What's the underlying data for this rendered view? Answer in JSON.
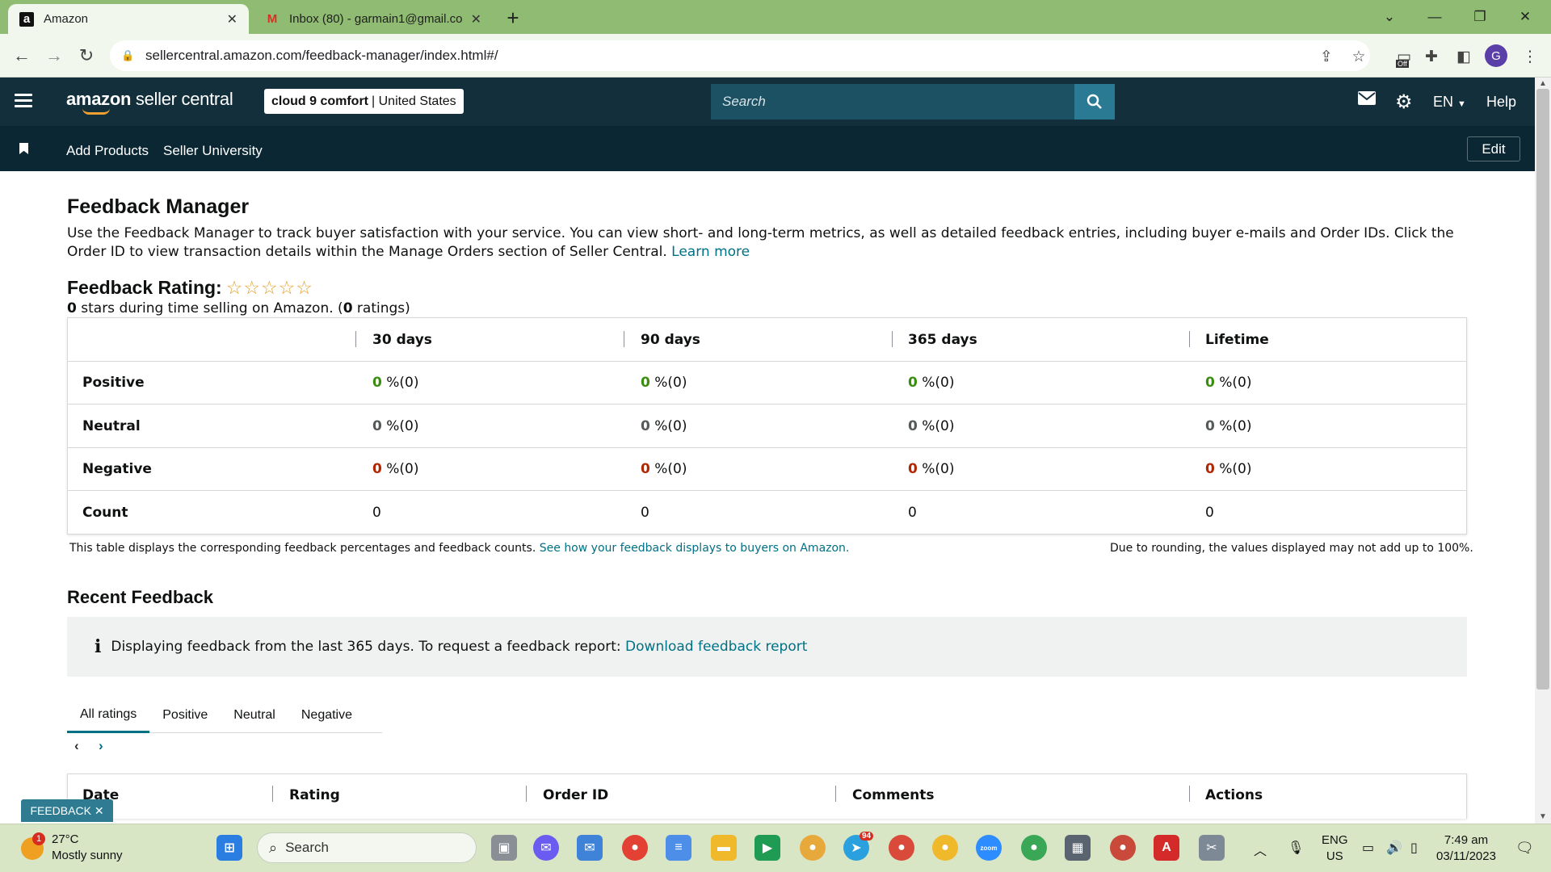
{
  "browser": {
    "tabs": [
      {
        "title": "Amazon",
        "favicon": "a"
      },
      {
        "title": "Inbox (80) - garmain1@gmail.co",
        "favicon": "M"
      }
    ],
    "url": "sellercentral.amazon.com/feedback-manager/index.html#/",
    "profile_initial": "G",
    "ext_badge": "Off"
  },
  "header": {
    "logo_brand": "amazon",
    "logo_rest": " seller central",
    "store_name": "cloud 9 comfort",
    "store_region": "| United States",
    "search_placeholder": "Search",
    "language": "EN",
    "help": "Help"
  },
  "nav": {
    "items": [
      "Add Products",
      "Seller University"
    ],
    "edit": "Edit"
  },
  "page": {
    "title": "Feedback Manager",
    "description": "Use the Feedback Manager to track buyer satisfaction with your service. You can view short- and long-term metrics, as well as detailed feedback entries, including buyer e-mails and Order IDs. Click the Order ID to view transaction details within the Manage Orders section of Seller Central.",
    "learn_more": "Learn more",
    "rating_label": "Feedback Rating:",
    "stars_rating": 0,
    "stars_text": "☆☆☆☆☆",
    "stars_summary_value": "0",
    "stars_summary_mid": " stars during time selling on Amazon. (",
    "ratings_count": "0",
    "stars_summary_end": " ratings)"
  },
  "feedback_table": {
    "columns": [
      "30 days",
      "90 days",
      "365 days",
      "Lifetime"
    ],
    "rows": [
      {
        "label": "Positive",
        "values": [
          "0",
          "0",
          "0",
          "0"
        ],
        "suffix": " %(0)"
      },
      {
        "label": "Neutral",
        "values": [
          "0",
          "0",
          "0",
          "0"
        ],
        "suffix": " %(0)"
      },
      {
        "label": "Negative",
        "values": [
          "0",
          "0",
          "0",
          "0"
        ],
        "suffix": " %(0)"
      },
      {
        "label": "Count",
        "values": [
          "0",
          "0",
          "0",
          "0"
        ],
        "suffix": ""
      }
    ],
    "note_left": "This table displays the corresponding feedback percentages and feedback counts.",
    "note_link": "See how your feedback displays to buyers on Amazon.",
    "note_right": "Due to rounding, the values displayed may not add up to 100%."
  },
  "recent": {
    "title": "Recent Feedback",
    "info": "Displaying feedback from the last 365 days. To request a feedback report:",
    "info_link": "Download feedback report",
    "tabs": [
      "All ratings",
      "Positive",
      "Neutral",
      "Negative"
    ],
    "columns": [
      "Date",
      "Rating",
      "Order ID",
      "Comments",
      "Actions"
    ],
    "feedback_tab": "FEEDBACK"
  },
  "taskbar": {
    "temp": "27°C",
    "weather": "Mostly sunny",
    "weather_badge": "1",
    "search": "Search",
    "lang1": "ENG",
    "lang2": "US",
    "time": "7:49 am",
    "date": "03/11/2023",
    "telegram_badge": "94"
  },
  "colors": {
    "header": "#122f3b",
    "nav": "#0b2733",
    "link": "#007185",
    "positive": "#3a8d0e",
    "negative": "#b12704",
    "tabbar": "#8fbb72"
  }
}
